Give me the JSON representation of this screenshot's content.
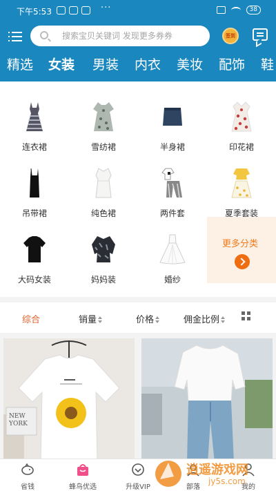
{
  "status_bar": {
    "time": "下午5:53",
    "dots": "···",
    "battery": "38"
  },
  "search": {
    "placeholder": "搜索宝贝关键词 发现更多券券"
  },
  "signin_badge": "签到",
  "tabs": [
    {
      "label": "精选"
    },
    {
      "label": "女装"
    },
    {
      "label": "男装"
    },
    {
      "label": "内衣"
    },
    {
      "label": "美妆"
    },
    {
      "label": "配饰"
    },
    {
      "label": "鞋"
    }
  ],
  "categories": [
    {
      "label": "连衣裙",
      "icon": "striped-dress-icon"
    },
    {
      "label": "雪纺裙",
      "icon": "floral-dress-icon"
    },
    {
      "label": "半身裙",
      "icon": "denim-skirt-icon"
    },
    {
      "label": "印花裙",
      "icon": "print-dress-icon"
    },
    {
      "label": "吊带裙",
      "icon": "slip-dress-icon"
    },
    {
      "label": "纯色裙",
      "icon": "white-dress-icon"
    },
    {
      "label": "两件套",
      "icon": "two-piece-icon"
    },
    {
      "label": "夏季套装",
      "icon": "summer-set-icon"
    },
    {
      "label": "大码女装",
      "icon": "black-tee-icon"
    },
    {
      "label": "妈妈装",
      "icon": "mom-blouse-icon"
    },
    {
      "label": "婚纱",
      "icon": "wedding-gown-icon"
    }
  ],
  "more_categories": "更多分类",
  "sort": {
    "comprehensive": "综合",
    "sales": "销量",
    "price": "价格",
    "commission": "佣金比例"
  },
  "products": [
    {
      "print_text": "NEW YORK",
      "alt": "white t-shirt with sunflower print"
    },
    {
      "alt": "white tee with high-waist jeans"
    }
  ],
  "bottom_nav": [
    {
      "label": "省钱",
      "icon": "piggy-bank-icon"
    },
    {
      "label": "蜂鸟优选",
      "icon": "shopping-bag-icon"
    },
    {
      "label": "升级VIP",
      "icon": "vip-icon"
    },
    {
      "label": "部落",
      "icon": "community-icon"
    },
    {
      "label": "我的",
      "icon": "user-icon"
    }
  ],
  "watermark": {
    "text": "逍遥游戏网",
    "sub": "jy5s.com"
  },
  "colors": {
    "header": "#1a87bf",
    "accent": "#e0632d",
    "more_bg": "#fdf1e6"
  }
}
